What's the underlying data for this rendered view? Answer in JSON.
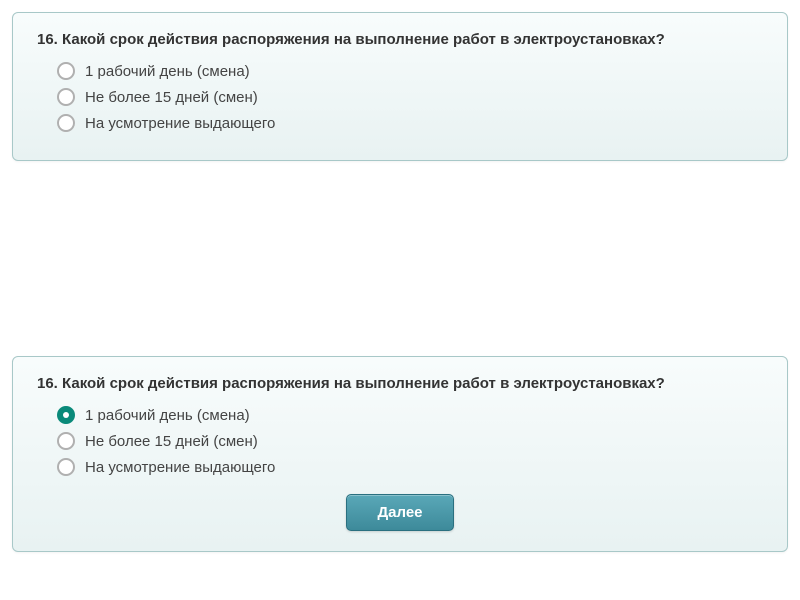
{
  "card1": {
    "question_number": "16.",
    "question_text": "Какой срок действия распоряжения на выполнение работ в электроустановках?",
    "options": [
      {
        "label": "1 рабочий день (смена)",
        "selected": false
      },
      {
        "label": "Не более 15 дней (смен)",
        "selected": false
      },
      {
        "label": "На усмотрение выдающего",
        "selected": false
      }
    ]
  },
  "card2": {
    "question_number": "16.",
    "question_text": "Какой срок действия распоряжения на выполнение работ в электроустановках?",
    "options": [
      {
        "label": "1 рабочий день (смена)",
        "selected": true
      },
      {
        "label": "Не более 15 дней (смен)",
        "selected": false
      },
      {
        "label": "На усмотрение выдающего",
        "selected": false
      }
    ],
    "next_button": "Далее"
  }
}
